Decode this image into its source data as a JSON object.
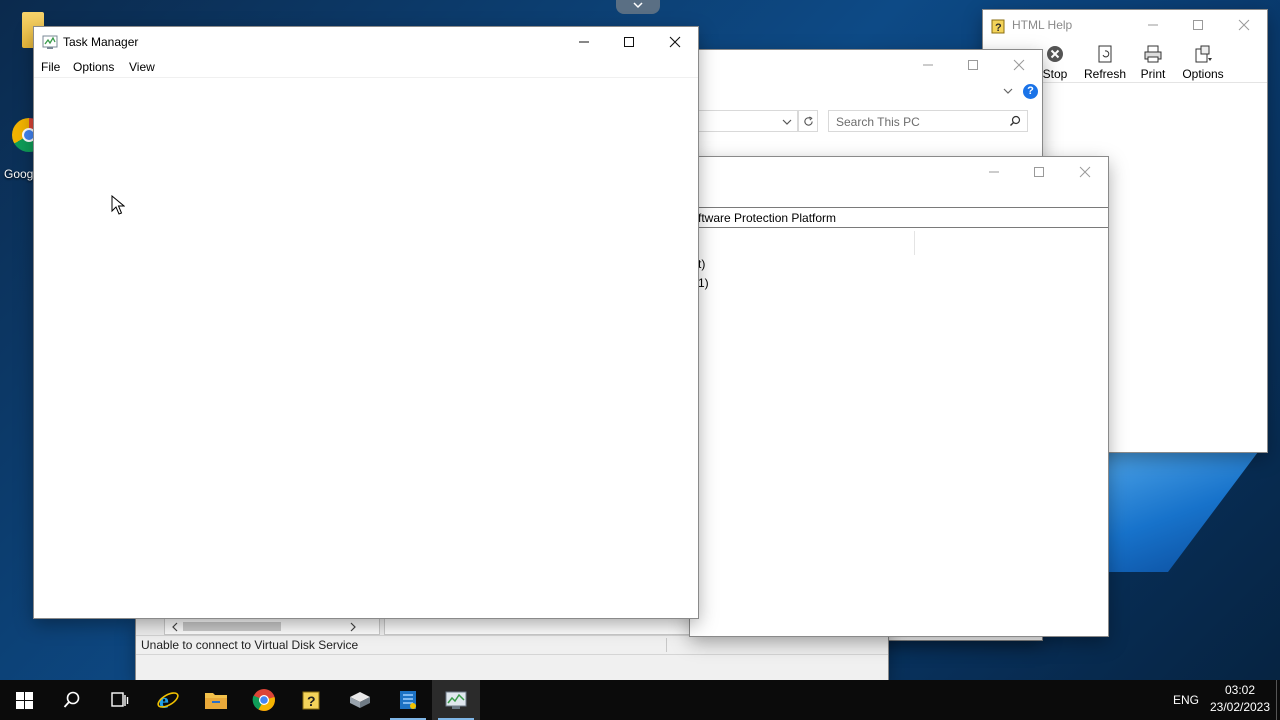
{
  "desktop": {
    "chrome_shortcut_label": "Goog"
  },
  "html_help": {
    "title": "HTML Help",
    "toolbar": [
      {
        "label": "Stop",
        "icon": "stop-icon"
      },
      {
        "label": "Refresh",
        "icon": "refresh-icon"
      },
      {
        "label": "Print",
        "icon": "print-icon"
      },
      {
        "label": "Options",
        "icon": "options-icon"
      }
    ]
  },
  "explorer": {
    "search_placeholder": "Search This PC"
  },
  "services_window": {
    "header_text": "ftware Protection Platform",
    "line1": "t)",
    "line2": "1)"
  },
  "disk_mgmt": {
    "status_text": "Unable to connect to Virtual Disk Service"
  },
  "task_manager": {
    "title": "Task Manager",
    "menu": [
      "File",
      "Options",
      "View"
    ]
  },
  "taskbar": {
    "items": [
      "start",
      "search",
      "task-view",
      "internet-explorer",
      "file-explorer",
      "chrome",
      "html-help",
      "hyper-v",
      "server-manager",
      "task-manager"
    ],
    "language": "ENG",
    "time": "03:02",
    "date": "23/02/2023"
  },
  "colors": {
    "accent_blue": "#1a73e8",
    "taskbar_bg": "#0b0b0b"
  }
}
